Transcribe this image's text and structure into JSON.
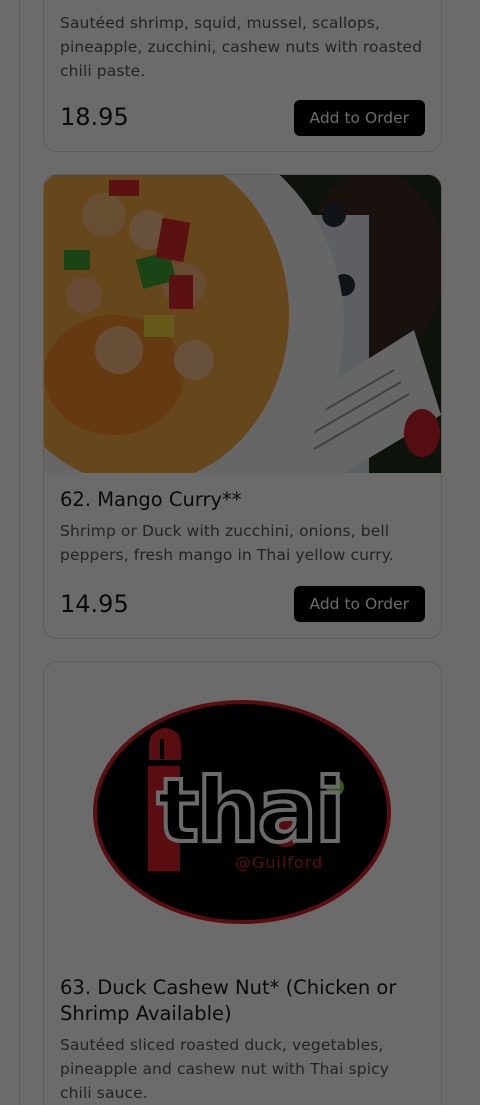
{
  "items": [
    {
      "description": "Sautéed shrimp, squid, mussel, scallops, pineapple, zucchini, cashew nuts with roasted chili paste.",
      "price": "18.95",
      "button_label": "Add to Order"
    },
    {
      "title": "62. Mango Curry**",
      "description": "Shrimp or Duck with zucchini, onions, bell peppers, fresh mango in Thai yellow curry.",
      "price": "14.95",
      "button_label": "Add to Order",
      "image": "mango-curry-photo"
    },
    {
      "title": "63. Duck Cashew Nut* (Chicken or Shrimp Available)",
      "description": "Sautéed sliced roasted duck, vegetables, pineapple and cashew nut with Thai spicy chili sauce.",
      "image": "restaurant-logo",
      "logo_text": "thai",
      "logo_subtext": "@Guilford"
    }
  ],
  "colors": {
    "button_bg": "#000000",
    "button_text": "#ffffff",
    "logo_red": "#d62028",
    "logo_black": "#000000",
    "dim_overlay": "rgba(0,0,0,0.58)"
  }
}
